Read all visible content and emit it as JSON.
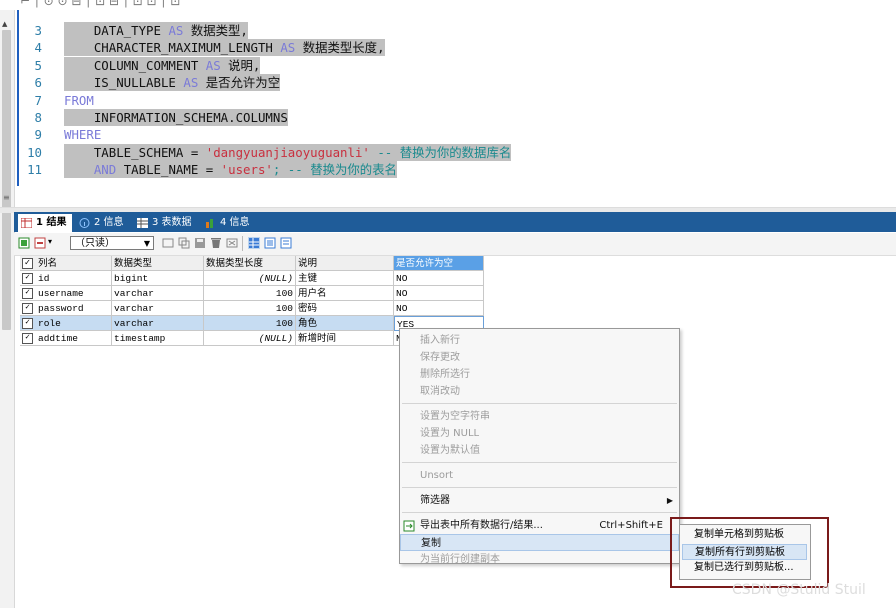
{
  "editor": {
    "lines": [
      {
        "n": "3",
        "parts": [
          {
            "t": "    DATA_TYPE ",
            "c": "id"
          },
          {
            "t": "AS",
            "c": "kw"
          },
          {
            "t": " 数据类型,",
            "c": "id"
          }
        ]
      },
      {
        "n": "4",
        "parts": [
          {
            "t": "    CHARACTER_MAXIMUM_LENGTH ",
            "c": "id"
          },
          {
            "t": "AS",
            "c": "kw"
          },
          {
            "t": " 数据类型长度,",
            "c": "id"
          }
        ]
      },
      {
        "n": "5",
        "parts": [
          {
            "t": "    COLUMN_COMMENT ",
            "c": "id"
          },
          {
            "t": "AS",
            "c": "kw"
          },
          {
            "t": " 说明,",
            "c": "id"
          }
        ]
      },
      {
        "n": "6",
        "parts": [
          {
            "t": "    IS_NULLABLE ",
            "c": "id"
          },
          {
            "t": "AS",
            "c": "kw"
          },
          {
            "t": " 是否允许为空",
            "c": "id"
          }
        ]
      },
      {
        "n": "7",
        "parts": [
          {
            "t": "FROM",
            "c": "kw"
          }
        ]
      },
      {
        "n": "8",
        "parts": [
          {
            "t": "    INFORMATION_SCHEMA.COLUMNS",
            "c": "id"
          }
        ]
      },
      {
        "n": "9",
        "parts": [
          {
            "t": "WHERE",
            "c": "kw"
          }
        ]
      },
      {
        "n": "10",
        "parts": [
          {
            "t": "    TABLE_SCHEMA = ",
            "c": "id"
          },
          {
            "t": "'dangyuanjiaoyuguanli'",
            "c": "str"
          },
          {
            "t": " -- 替换为你的数据库名",
            "c": "cmt"
          }
        ]
      },
      {
        "n": "11",
        "parts": [
          {
            "t": "    ",
            "c": "id"
          },
          {
            "t": "AND",
            "c": "kw"
          },
          {
            "t": " TABLE_NAME = ",
            "c": "id"
          },
          {
            "t": "'users'",
            "c": "str"
          },
          {
            "t": "; -- 替换为你的表名",
            "c": "cmt"
          }
        ]
      }
    ]
  },
  "tabs": [
    {
      "label": "1 结果",
      "active": true
    },
    {
      "label": "2 信息",
      "active": false
    },
    {
      "label": "3 表数据",
      "active": false
    },
    {
      "label": "4 信息",
      "active": false
    }
  ],
  "toolbar": {
    "mode_select": "（只读）"
  },
  "grid": {
    "headers": [
      "列名",
      "数据类型",
      "数据类型长度",
      "说明",
      "是否允许为空"
    ],
    "rows": [
      [
        "id",
        "bigint",
        "(NULL)",
        "主键",
        "NO"
      ],
      [
        "username",
        "varchar",
        "100",
        "用户名",
        "NO"
      ],
      [
        "password",
        "varchar",
        "100",
        "密码",
        "NO"
      ],
      [
        "role",
        "varchar",
        "100",
        "角色",
        "YES"
      ],
      [
        "addtime",
        "timestamp",
        "(NULL)",
        "新增时间",
        "N"
      ]
    ],
    "selected_row": 3
  },
  "context_menu": {
    "items": [
      {
        "label": "插入新行",
        "enabled": false
      },
      {
        "label": "保存更改",
        "enabled": false
      },
      {
        "label": "删除所选行",
        "enabled": false
      },
      {
        "label": "取消改动",
        "enabled": false
      },
      {
        "sep": true
      },
      {
        "label": "设置为空字符串",
        "enabled": false
      },
      {
        "label": "设置为 NULL",
        "enabled": false
      },
      {
        "label": "设置为默认值",
        "enabled": false
      },
      {
        "sep": true
      },
      {
        "label": "Unsort",
        "enabled": false
      },
      {
        "sep": true
      },
      {
        "label": "筛选器",
        "enabled": true,
        "submenu": true
      },
      {
        "sep": true
      },
      {
        "label": "导出表中所有数据行/结果...",
        "enabled": true,
        "shortcut": "Ctrl+Shift+E",
        "icon": true
      },
      {
        "label": "复制",
        "enabled": true,
        "highlight": true
      },
      {
        "label": "为当前行创建副本",
        "enabled": false
      }
    ]
  },
  "copy_submenu": {
    "items": [
      {
        "label": "复制单元格到剪贴板"
      },
      {
        "label": "复制所有行到剪贴板",
        "highlight": true
      },
      {
        "label": "复制已选行到剪贴板..."
      }
    ]
  },
  "watermark": "CSDN @Stulid Stuil"
}
